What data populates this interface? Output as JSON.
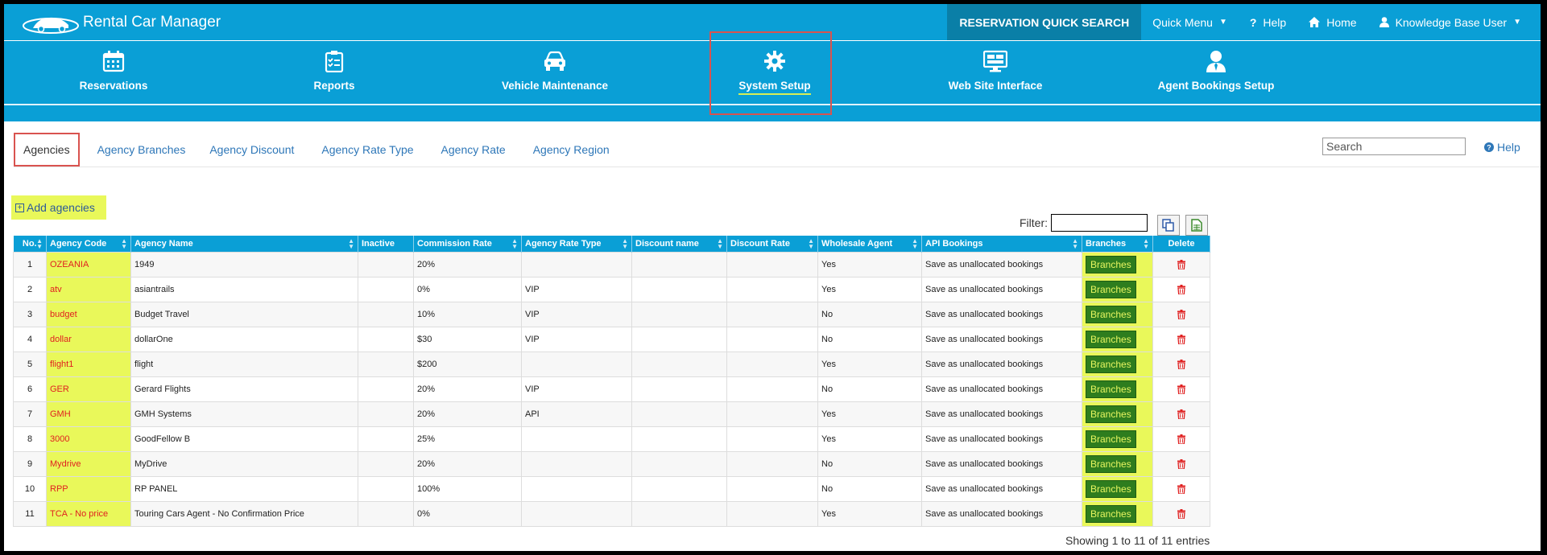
{
  "app": {
    "title": "Rental Car Manager"
  },
  "topnav": {
    "quick_search": "RESERVATION QUICK SEARCH",
    "quick_menu": "Quick Menu",
    "help": "Help",
    "home": "Home",
    "user": "Knowledge Base User"
  },
  "mainnav": [
    {
      "label": "Reservations",
      "icon": "calendar-icon"
    },
    {
      "label": "Reports",
      "icon": "clipboard-icon"
    },
    {
      "label": "Vehicle Maintenance",
      "icon": "car-icon"
    },
    {
      "label": "System Setup",
      "icon": "gear-icon",
      "active": true
    },
    {
      "label": "Web Site Interface",
      "icon": "monitor-icon"
    },
    {
      "label": "Agent Bookings Setup",
      "icon": "user-icon"
    }
  ],
  "subtabs": [
    "Agencies",
    "Agency Branches",
    "Agency Discount",
    "Agency Rate Type",
    "Agency Rate",
    "Agency Region"
  ],
  "search": {
    "placeholder": "Search"
  },
  "help_label": "Help",
  "add_label": "Add agencies",
  "filter_label": "Filter:",
  "table": {
    "headers": [
      "No.",
      "Agency Code",
      "Agency Name",
      "Inactive",
      "Commission Rate",
      "Agency Rate Type",
      "Discount name",
      "Discount Rate",
      "Wholesale Agent",
      "API Bookings",
      "Branches",
      "Delete"
    ],
    "branch_label": "Branches",
    "rows": [
      {
        "no": "1",
        "code": "OZEANIA",
        "name": "1949",
        "inactive": "",
        "commission": "20%",
        "rate_type": "",
        "discount_name": "",
        "discount_rate": "",
        "wholesale": "Yes",
        "api": "Save as unallocated bookings"
      },
      {
        "no": "2",
        "code": "atv",
        "name": "asiantrails",
        "inactive": "",
        "commission": "0%",
        "rate_type": "VIP",
        "discount_name": "",
        "discount_rate": "",
        "wholesale": "Yes",
        "api": "Save as unallocated bookings"
      },
      {
        "no": "3",
        "code": "budget",
        "name": "Budget Travel",
        "inactive": "",
        "commission": "10%",
        "rate_type": "VIP",
        "discount_name": "",
        "discount_rate": "",
        "wholesale": "No",
        "api": "Save as unallocated bookings"
      },
      {
        "no": "4",
        "code": "dollar",
        "name": "dollarOne",
        "inactive": "",
        "commission": "$30",
        "rate_type": "VIP",
        "discount_name": "",
        "discount_rate": "",
        "wholesale": "No",
        "api": "Save as unallocated bookings"
      },
      {
        "no": "5",
        "code": "flight1",
        "name": "flight",
        "inactive": "",
        "commission": "$200",
        "rate_type": "",
        "discount_name": "",
        "discount_rate": "",
        "wholesale": "Yes",
        "api": "Save as unallocated bookings"
      },
      {
        "no": "6",
        "code": "GER",
        "name": "Gerard Flights",
        "inactive": "",
        "commission": "20%",
        "rate_type": "VIP",
        "discount_name": "",
        "discount_rate": "",
        "wholesale": "No",
        "api": "Save as unallocated bookings"
      },
      {
        "no": "7",
        "code": "GMH",
        "name": "GMH Systems",
        "inactive": "",
        "commission": "20%",
        "rate_type": "API",
        "discount_name": "",
        "discount_rate": "",
        "wholesale": "Yes",
        "api": "Save as unallocated bookings"
      },
      {
        "no": "8",
        "code": "3000",
        "name": "GoodFellow B",
        "inactive": "",
        "commission": "25%",
        "rate_type": "",
        "discount_name": "",
        "discount_rate": "",
        "wholesale": "Yes",
        "api": "Save as unallocated bookings"
      },
      {
        "no": "9",
        "code": "Mydrive",
        "name": "MyDrive",
        "inactive": "",
        "commission": "20%",
        "rate_type": "",
        "discount_name": "",
        "discount_rate": "",
        "wholesale": "No",
        "api": "Save as unallocated bookings"
      },
      {
        "no": "10",
        "code": "RPP",
        "name": "RP PANEL",
        "inactive": "",
        "commission": "100%",
        "rate_type": "",
        "discount_name": "",
        "discount_rate": "",
        "wholesale": "No",
        "api": "Save as unallocated bookings"
      },
      {
        "no": "11",
        "code": "TCA - No price",
        "name": "Touring Cars Agent - No Confirmation Price",
        "inactive": "",
        "commission": "0%",
        "rate_type": "",
        "discount_name": "",
        "discount_rate": "",
        "wholesale": "Yes",
        "api": "Save as unallocated bookings"
      }
    ]
  },
  "showing": "Showing 1 to 11 of 11 entries",
  "colors": {
    "brand": "#0a9fd6",
    "highlight": "#e9f85a",
    "annotation": "#d9534f",
    "branch_button": "#2e7d1e",
    "delete": "#e02020"
  }
}
